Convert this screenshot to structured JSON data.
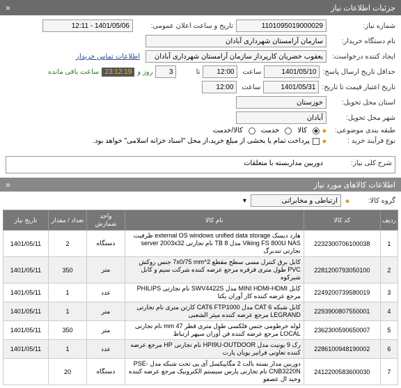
{
  "header": {
    "title": "جزئیات اطلاعات نیاز",
    "collapse": "«"
  },
  "form": {
    "need_no_label": "شماره نیاز:",
    "need_no": "1101095019000029",
    "announce_label": "تاریخ و ساعت اعلان عمومی:",
    "announce_val": "1401/05/06 - 12:11",
    "org_label": "نام دستگاه خریدار:",
    "org_val": "سازمان آرامستان شهرداری آبادان",
    "requester_label": "ایجاد کننده درخواست:",
    "requester_val": "یعقوب خضریان کارپرداز سازمان آرامستان شهرداری آبادان",
    "contact_link": "اطلاعات تماس خریدار",
    "deadline_label": "حداقل تاریخ ارسال پاسخ:",
    "deadline_date": "1401/05/10",
    "time_label": "ساعت",
    "deadline_time": "12:00",
    "days_label": "تا",
    "days_val": "3",
    "days_after": "روز و",
    "remaining_val": "23:12:19",
    "remaining_after": "ساعت باقی مانده",
    "expiry_label": "تاریخ اعتبار قیمت تا تاریخ:",
    "expiry_date": "1401/05/31",
    "expiry_time": "12:00",
    "province_label": "استان محل تحویل:",
    "province_val": "خوزستان",
    "city_label": "شهر محل تحویل:",
    "city_val": "آبادان",
    "category_label": "طبقه بندی موضوعی:",
    "cat_goods": "کالا",
    "cat_service": "خدمت",
    "cat_both": "کالا/خدمت",
    "process_label": "نوع فرآیند خرید :",
    "process_note": "پرداخت تمام یا بخشی از مبلغ خرید،از محل \"اسناد خزانه اسلامی\" خواهد بود.",
    "bullet": "◆"
  },
  "desc": {
    "label": "شرح کلی نیاز:",
    "text": "دوربین مداربسته با متعلقات"
  },
  "items_header": "اطلاعات کالاهای مورد نیاز",
  "group": {
    "label": "گروه کالا:",
    "val": "ارتباطی و مخابراتی",
    "chev": "▾"
  },
  "cols": {
    "idx": "ردیف",
    "code": "کد کالا",
    "name": "نام کالا",
    "unit": "واحد شمارش",
    "qty": "تعداد / مقدار",
    "date": "تاریخ نیاز"
  },
  "rows": [
    {
      "idx": "1",
      "code": "2232300706100038",
      "name": "هارد دیسک external OS windows unified data storage ظرفیت Viking FS 800U NAS مدل TB 8 نام تجارتی server 2003x32 تجارتی تندبرگ",
      "unit": "دستگاه",
      "qty": "2",
      "date": "1401/05/11"
    },
    {
      "idx": "2",
      "code": "2281200793050100",
      "name": "کابل برق کنترل مسی سطح مقطع 7x0/75 mm^2 جنس روکش PVC طول متری فرقره مرجع عرضه کننده شرکت سیم و کابل شیرکوه",
      "unit": "متر",
      "qty": "350",
      "date": "1401/05/11"
    },
    {
      "idx": "3",
      "code": "2249200739580019",
      "name": "کابل MINI HDMI-HDMI مدل SWV4422S نام تجارتی PHILIPS مرجع عرضه کننده کار آوران یکتا",
      "unit": "عدد",
      "qty": "1",
      "date": "1401/05/11"
    },
    {
      "idx": "4",
      "code": "2293900807550001",
      "name": "کابل شبکه CAT 6 مدل CAT6 FTP1000 کارتن متری نام تجارتی LEGRAND مرجع عرضه کننده میثر الشعبی",
      "unit": "متر",
      "qty": "1",
      "date": "1401/05/11"
    },
    {
      "idx": "5",
      "code": "2362300590650007",
      "name": "لوله خرطومی جنس فلکسی طول متری قطر mm 47 نام تجارتی LOCAL مرجع عرضه کننده فن آوران سپهر ارتباط",
      "unit": "متر",
      "qty": "350",
      "date": "1401/05/11"
    },
    {
      "idx": "6",
      "code": "2286100948190002",
      "name": "رک 9 یونیت مدل HPI9U-OUTDOOR نام تجارتی HP مرجع عرضه کننده تعاونی فرانیر پویان پارت",
      "unit": "عدد",
      "qty": "1",
      "date": "1401/05/11"
    },
    {
      "idx": "7",
      "code": "2412200583600030",
      "name": "دوربین مدار بسته بالت 2 مگاپیکسل آی پی تحت شبکه مدل PSE-CNB3220N نام تجارتی پارس سیستم الکترونیک مرجع عرضه کننده وحید ال عصفو",
      "unit": "دستگاه",
      "qty": "20",
      "date": ""
    }
  ]
}
